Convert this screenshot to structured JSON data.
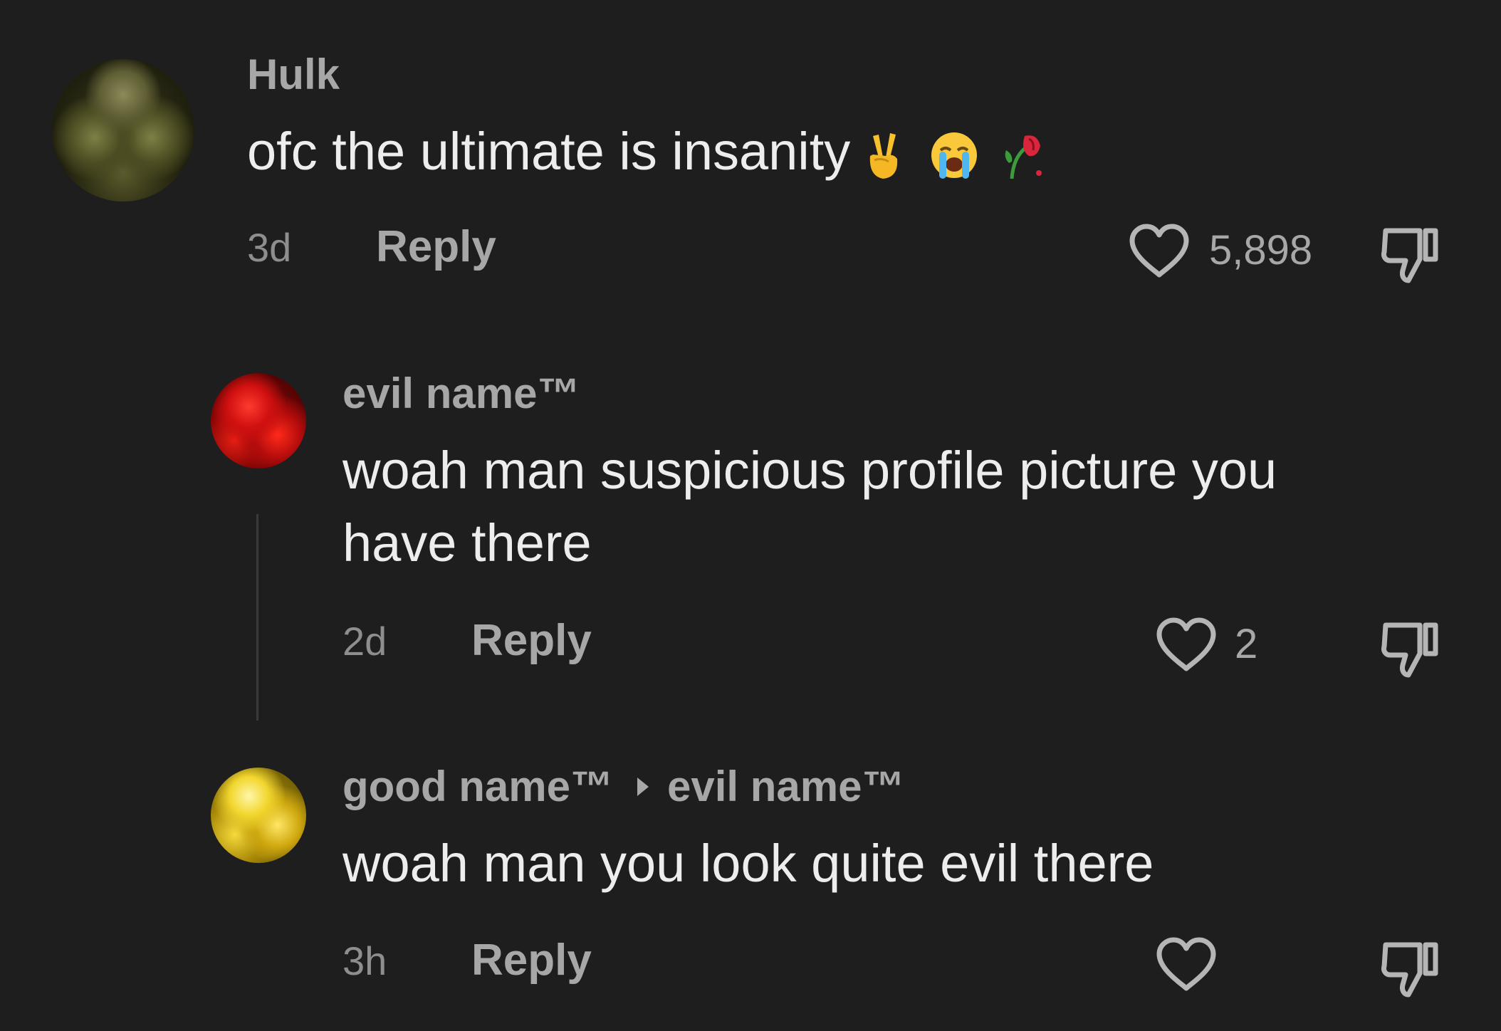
{
  "comments": [
    {
      "username": "Hulk",
      "text": "ofc the ultimate is insanity",
      "emojis": [
        "victory-hand-emoji",
        "loudly-crying-face-emoji",
        "wilted-flower-emoji"
      ],
      "time": "3d",
      "reply_label": "Reply",
      "likes": "5,898"
    },
    {
      "username": "evil name™",
      "text_line1": "woah man suspicious profile picture you",
      "text_line2": "have there",
      "time": "2d",
      "reply_label": "Reply",
      "likes": "2"
    },
    {
      "username": "good name™",
      "reply_to": "evil name™",
      "text": "woah man you look quite evil there",
      "time": "3h",
      "reply_label": "Reply",
      "likes": ""
    }
  ],
  "colors": {
    "background": "#1e1e1f",
    "text_primary": "#ededed",
    "text_secondary": "#a7a7a7",
    "text_muted": "#8e8e8e"
  }
}
